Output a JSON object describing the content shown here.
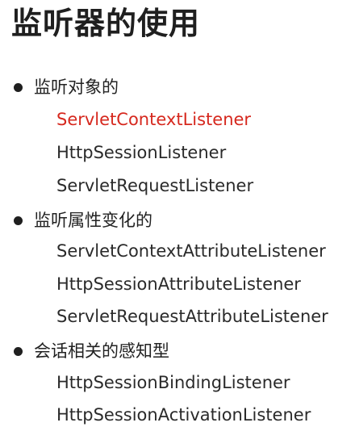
{
  "title": "监听器的使用",
  "sections": [
    {
      "heading": "监听对象的",
      "items": [
        {
          "label": "ServletContextListener",
          "color": "#d6281e"
        },
        {
          "label": "HttpSessionListener",
          "color": "#2a2a2a"
        },
        {
          "label": "ServletRequestListener",
          "color": "#2a2a2a"
        }
      ]
    },
    {
      "heading": "监听属性变化的",
      "items": [
        {
          "label": "ServletContextAttributeListener",
          "color": "#2a2a2a"
        },
        {
          "label": "HttpSessionAttributeListener",
          "color": "#2a2a2a"
        },
        {
          "label": "ServletRequestAttributeListener",
          "color": "#2a2a2a"
        }
      ]
    },
    {
      "heading": "会话相关的感知型",
      "items": [
        {
          "label": "HttpSessionBindingListener",
          "color": "#2a2a2a"
        },
        {
          "label": "HttpSessionActivationListener",
          "color": "#2a2a2a"
        }
      ]
    }
  ]
}
